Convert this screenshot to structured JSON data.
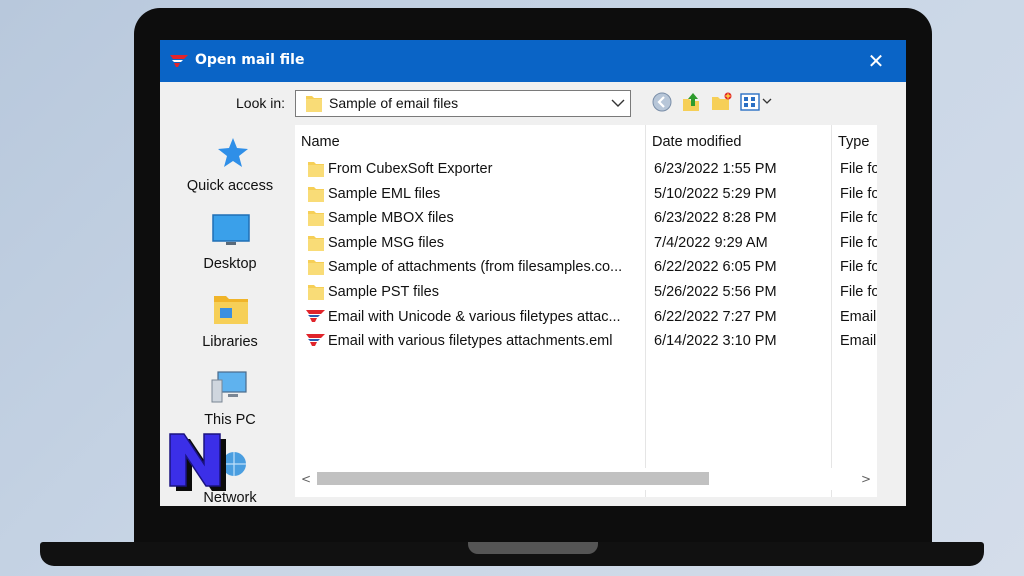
{
  "window": {
    "title": "Open mail file",
    "close_glyph": "✕"
  },
  "lookin": {
    "label": "Look in:",
    "value": "Sample of email files"
  },
  "toolbar": {
    "icons": [
      "back-icon",
      "up-folder-icon",
      "new-folder-icon",
      "view-menu-icon"
    ]
  },
  "places": [
    {
      "label": "Quick access",
      "icon": "star-icon"
    },
    {
      "label": "Desktop",
      "icon": "desktop-icon"
    },
    {
      "label": "Libraries",
      "icon": "libraries-icon"
    },
    {
      "label": "This PC",
      "icon": "computer-icon"
    },
    {
      "label": "Network",
      "icon": "network-icon"
    }
  ],
  "columns": {
    "name": "Name",
    "date": "Date modified",
    "type": "Type"
  },
  "files": [
    {
      "name": "From CubexSoft Exporter",
      "date": "6/23/2022 1:55 PM",
      "type": "File fo",
      "kind": "folder"
    },
    {
      "name": "Sample EML files",
      "date": "5/10/2022 5:29 PM",
      "type": "File fo",
      "kind": "folder"
    },
    {
      "name": "Sample MBOX files",
      "date": "6/23/2022 8:28 PM",
      "type": "File fo",
      "kind": "folder"
    },
    {
      "name": "Sample MSG files",
      "date": "7/4/2022 9:29 AM",
      "type": "File fo",
      "kind": "folder"
    },
    {
      "name": "Sample of attachments (from filesamples.co...",
      "date": "6/22/2022 6:05 PM",
      "type": "File fo",
      "kind": "folder"
    },
    {
      "name": "Sample PST files",
      "date": "5/26/2022 5:56 PM",
      "type": "File fo",
      "kind": "folder"
    },
    {
      "name": "Email with Unicode & various filetypes attac...",
      "date": "6/22/2022 7:27 PM",
      "type": "Email",
      "kind": "email"
    },
    {
      "name": "Email with various filetypes attachments.eml",
      "date": "6/14/2022 3:10 PM",
      "type": "Email",
      "kind": "email"
    }
  ],
  "scroll": {
    "left_glyph": "<",
    "right_glyph": ">"
  },
  "colors": {
    "titlebar": "#0a64c6",
    "folder": "#f6cf57",
    "accent_red": "#e0242b"
  }
}
